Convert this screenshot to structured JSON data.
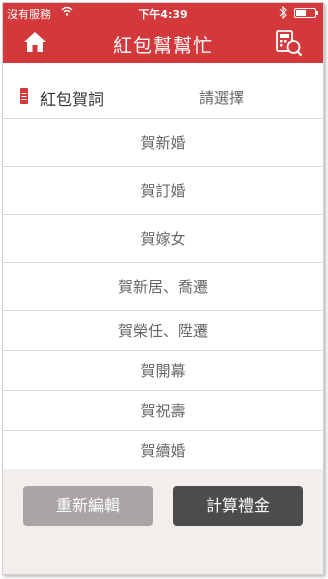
{
  "status_bar": {
    "carrier": "沒有服務",
    "time": "下午4:39",
    "battery_level": 0.55
  },
  "nav": {
    "title": "紅包幫幫忙",
    "home_icon": "home-icon",
    "calculator_icon": "calculator-search-icon"
  },
  "greeting_header": {
    "label": "紅包賀詞",
    "placeholder": "請選擇",
    "icon": "red-envelope-icon"
  },
  "options": [
    "賀新婚",
    "賀訂婚",
    "賀嫁女",
    "賀新居、喬遷",
    "賀榮任、陞遷",
    "賀開幕",
    "賀祝壽",
    "賀續婚"
  ],
  "footer": {
    "reset_label": "重新編輯",
    "calculate_label": "計算禮金"
  },
  "colors": {
    "brand_red": "#d3393a",
    "reset_button": "#a9a5a4",
    "calculate_button": "#4d4c4c",
    "footer_bg": "#f3eeec"
  }
}
